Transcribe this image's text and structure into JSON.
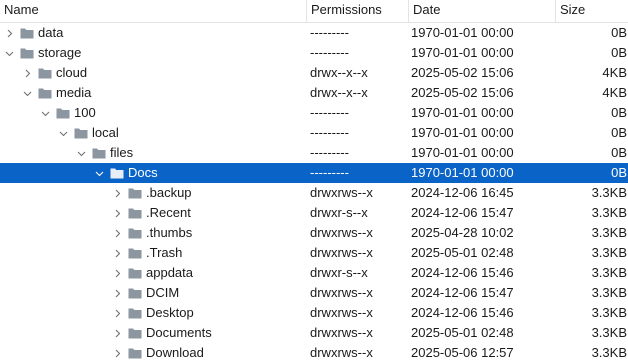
{
  "columns": {
    "name": "Name",
    "permissions": "Permissions",
    "date": "Date",
    "size": "Size"
  },
  "colors": {
    "folder": "#8c96a0",
    "selection": "#0a64c8",
    "chevron": "#707070"
  },
  "rows": [
    {
      "name": "data",
      "depth": 0,
      "expanded": false,
      "perm": "---------",
      "date": "1970-01-01 00:00",
      "size": "0B",
      "selected": false
    },
    {
      "name": "storage",
      "depth": 0,
      "expanded": true,
      "perm": "---------",
      "date": "1970-01-01 00:00",
      "size": "0B",
      "selected": false
    },
    {
      "name": "cloud",
      "depth": 1,
      "expanded": false,
      "perm": "drwx--x--x",
      "date": "2025-05-02 15:06",
      "size": "4KB",
      "selected": false
    },
    {
      "name": "media",
      "depth": 1,
      "expanded": true,
      "perm": "drwx--x--x",
      "date": "2025-05-02 15:06",
      "size": "4KB",
      "selected": false
    },
    {
      "name": "100",
      "depth": 2,
      "expanded": true,
      "perm": "---------",
      "date": "1970-01-01 00:00",
      "size": "0B",
      "selected": false
    },
    {
      "name": "local",
      "depth": 3,
      "expanded": true,
      "perm": "---------",
      "date": "1970-01-01 00:00",
      "size": "0B",
      "selected": false
    },
    {
      "name": "files",
      "depth": 4,
      "expanded": true,
      "perm": "---------",
      "date": "1970-01-01 00:00",
      "size": "0B",
      "selected": false
    },
    {
      "name": "Docs",
      "depth": 5,
      "expanded": true,
      "perm": "---------",
      "date": "1970-01-01 00:00",
      "size": "0B",
      "selected": true
    },
    {
      "name": ".backup",
      "depth": 6,
      "expanded": false,
      "perm": "drwxrws--x",
      "date": "2024-12-06 16:45",
      "size": "3.3KB",
      "selected": false
    },
    {
      "name": ".Recent",
      "depth": 6,
      "expanded": false,
      "perm": "drwxr-s--x",
      "date": "2024-12-06 15:47",
      "size": "3.3KB",
      "selected": false
    },
    {
      "name": ".thumbs",
      "depth": 6,
      "expanded": false,
      "perm": "drwxrws--x",
      "date": "2025-04-28 10:02",
      "size": "3.3KB",
      "selected": false
    },
    {
      "name": ".Trash",
      "depth": 6,
      "expanded": false,
      "perm": "drwxrws--x",
      "date": "2025-05-01 02:48",
      "size": "3.3KB",
      "selected": false
    },
    {
      "name": "appdata",
      "depth": 6,
      "expanded": false,
      "perm": "drwxr-s--x",
      "date": "2024-12-06 15:46",
      "size": "3.3KB",
      "selected": false
    },
    {
      "name": "DCIM",
      "depth": 6,
      "expanded": false,
      "perm": "drwxrws--x",
      "date": "2024-12-06 15:47",
      "size": "3.3KB",
      "selected": false
    },
    {
      "name": "Desktop",
      "depth": 6,
      "expanded": false,
      "perm": "drwxrws--x",
      "date": "2024-12-06 15:46",
      "size": "3.3KB",
      "selected": false
    },
    {
      "name": "Documents",
      "depth": 6,
      "expanded": false,
      "perm": "drwxrws--x",
      "date": "2025-05-01 02:48",
      "size": "3.3KB",
      "selected": false
    },
    {
      "name": "Download",
      "depth": 6,
      "expanded": false,
      "perm": "drwxrws--x",
      "date": "2025-05-06 12:57",
      "size": "3.3KB",
      "selected": false
    }
  ]
}
